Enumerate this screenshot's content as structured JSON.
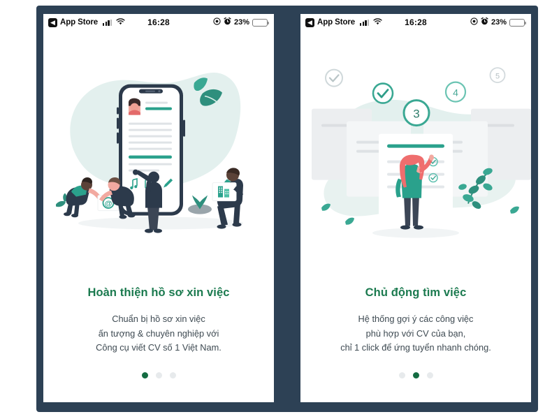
{
  "frame": {
    "background_color": "#2d4155",
    "page_background": "#ffffff"
  },
  "theme": {
    "heading_green": "#1b7a4f",
    "body_gray": "#3e4a52",
    "accent_teal": "#3aa893",
    "dot_active": "#146c42",
    "dot_inactive": "#e7eaec",
    "battery_yellow": "#f5c542"
  },
  "status_bar": {
    "back_label": "App Store",
    "back_glyph": "◀",
    "time": "16:28",
    "battery_percent": "23%",
    "battery_level": 23,
    "icons": [
      "back-chevron-icon",
      "signal-bars-icon",
      "wifi-icon",
      "location-icon",
      "alarm-icon",
      "battery-icon"
    ]
  },
  "screens": [
    {
      "id": "onboarding-slide-1",
      "headline": "Hoàn thiện hồ sơ xin việc",
      "body_lines": [
        "Chuẩn bị hồ sơ xin việc",
        "ấn tượng & chuyên nghiệp với",
        "Công cụ viết CV số 1 Việt Nam."
      ],
      "dots": {
        "count": 3,
        "active_index": 0
      },
      "illustration": {
        "name": "cv-builder-illustration",
        "elements": [
          "phone-mockup",
          "profile-avatar",
          "cv-text-lines",
          "music-icon",
          "image-icon",
          "pencil-icon",
          "person-carrying-envelope",
          "envelope-at-icon",
          "person-raising-arm",
          "person-carrying-chart-card",
          "leaf-decoration",
          "plant-decoration",
          "blob-background"
        ]
      }
    },
    {
      "id": "onboarding-slide-2",
      "headline": "Chủ động tìm việc",
      "body_lines": [
        "Hệ thống gợi ý các công việc",
        "phù hợp với CV của bạn,",
        "chỉ 1 click để ứng tuyển nhanh chóng."
      ],
      "dots": {
        "count": 3,
        "active_index": 1
      },
      "illustration": {
        "name": "job-matching-illustration",
        "step_badges": [
          {
            "label": "check",
            "state": "done-muted"
          },
          {
            "label": "check",
            "state": "done"
          },
          {
            "label": "3",
            "state": "current"
          },
          {
            "label": "4",
            "state": "upcoming"
          },
          {
            "label": "5",
            "state": "muted"
          }
        ],
        "elements": [
          "document-cards",
          "woman-reviewing-checklist",
          "checklist-check-icon",
          "plant-branch",
          "leaf-decoration",
          "blob-background"
        ]
      }
    }
  ]
}
